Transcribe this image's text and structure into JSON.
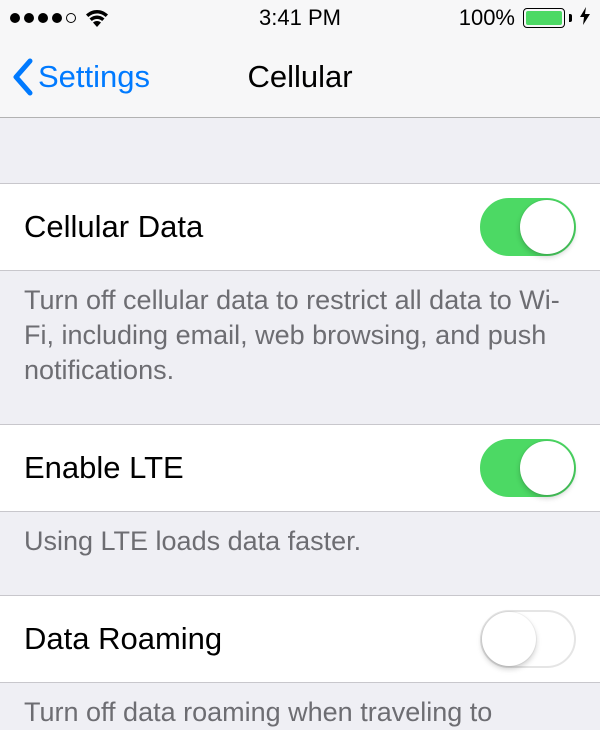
{
  "statusBar": {
    "time": "3:41 PM",
    "batteryPercent": "100%"
  },
  "nav": {
    "back": "Settings",
    "title": "Cellular"
  },
  "rows": {
    "cellularData": {
      "label": "Cellular Data",
      "footer": "Turn off cellular data to restrict all data to Wi-Fi, including email, web browsing, and push notifications."
    },
    "enableLTE": {
      "label": "Enable LTE",
      "footer": "Using LTE loads data faster."
    },
    "dataRoaming": {
      "label": "Data Roaming",
      "footer": "Turn off data roaming when traveling to"
    }
  },
  "toggles": {
    "cellularData": true,
    "enableLTE": true,
    "dataRoaming": false
  }
}
